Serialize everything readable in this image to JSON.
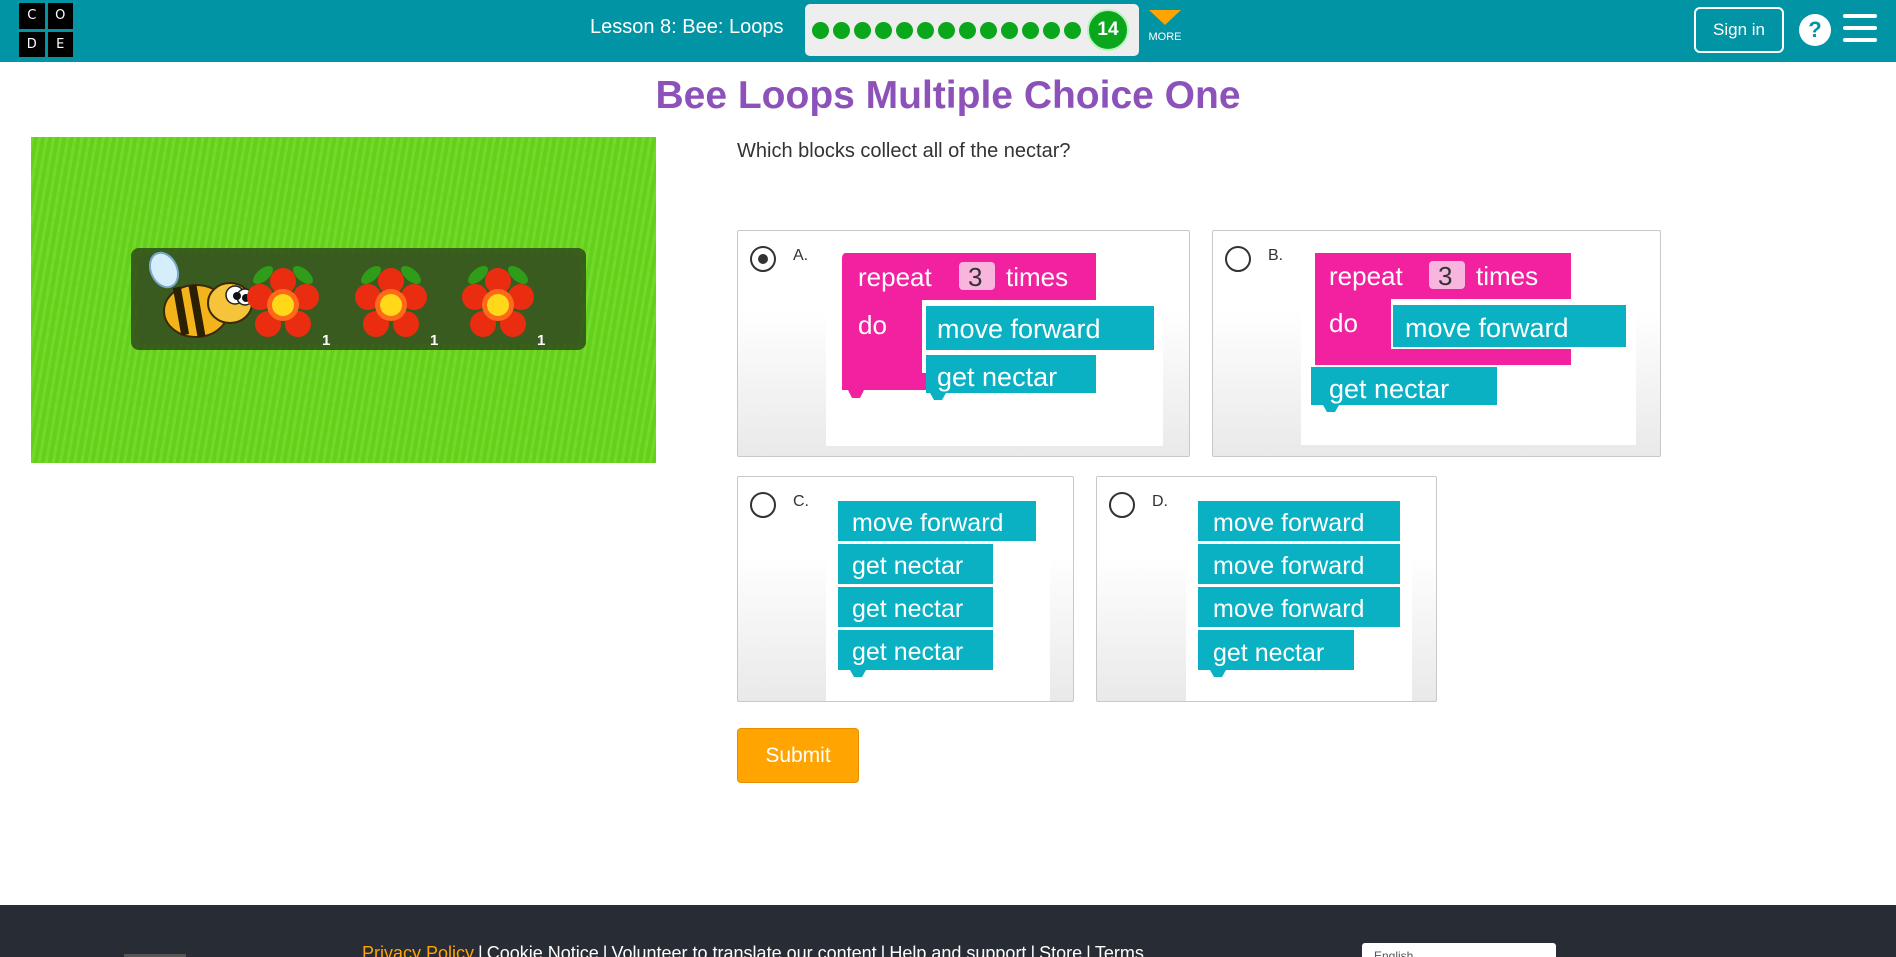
{
  "header": {
    "logo_letters": [
      "C",
      "O",
      "D",
      "E"
    ],
    "lesson_title": "Lesson 8: Bee: Loops",
    "progress": {
      "completed_count": 13,
      "current_level": "14",
      "color": "#0aa71c"
    },
    "more_label": "MORE",
    "sign_in_label": "Sign in",
    "help_label": "?",
    "colors": {
      "bar": "#0094a5",
      "accent": "#ffa400"
    }
  },
  "page_title": "Bee Loops Multiple Choice One",
  "question": "Which blocks collect all of the nectar?",
  "game": {
    "flower_counts": [
      "1",
      "1",
      "1"
    ]
  },
  "answers": [
    {
      "letter": "A.",
      "selected": true,
      "repeat_word": "repeat",
      "repeat_count": "3",
      "times_word": "times",
      "do_word": "do",
      "blocks": [
        "move forward",
        "get nectar"
      ]
    },
    {
      "letter": "B.",
      "selected": false,
      "repeat_word": "repeat",
      "repeat_count": "3",
      "times_word": "times",
      "do_word": "do",
      "blocks": [
        "move forward",
        "get nectar"
      ]
    },
    {
      "letter": "C.",
      "selected": false,
      "blocks": [
        "move forward",
        "get nectar",
        "get nectar",
        "get nectar"
      ]
    },
    {
      "letter": "D.",
      "selected": false,
      "blocks": [
        "move forward",
        "move forward",
        "move forward",
        "get nectar"
      ]
    }
  ],
  "block_colors": {
    "loop": "#f121a0",
    "action": "#0ab1c3"
  },
  "submit_label": "Submit",
  "footer": {
    "links": [
      "Privacy Policy",
      "Cookie Notice",
      "Volunteer to translate our content",
      "Help and support",
      "Store",
      "Terms"
    ],
    "language": "English"
  }
}
